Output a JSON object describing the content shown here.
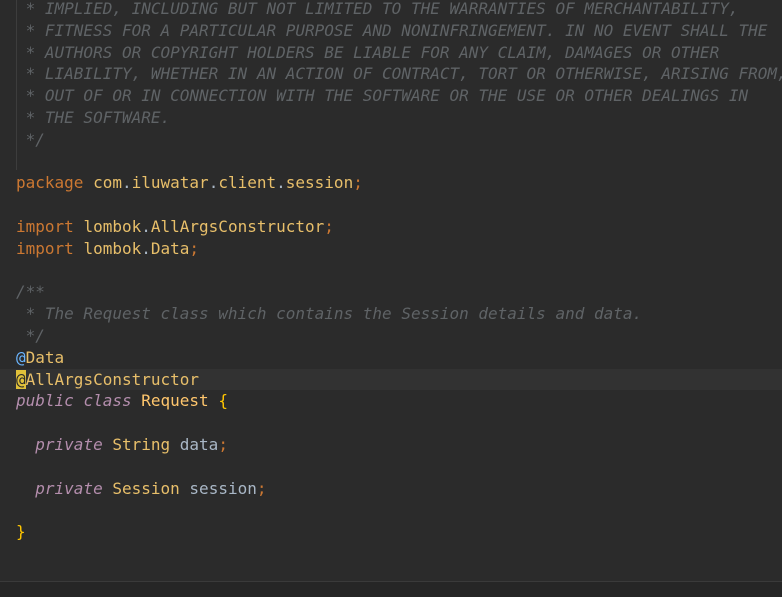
{
  "comment_header": [
    " * IMPLIED, INCLUDING BUT NOT LIMITED TO THE WARRANTIES OF MERCHANTABILITY,",
    " * FITNESS FOR A PARTICULAR PURPOSE AND NONINFRINGEMENT. IN NO EVENT SHALL THE",
    " * AUTHORS OR COPYRIGHT HOLDERS BE LIABLE FOR ANY CLAIM, DAMAGES OR OTHER",
    " * LIABILITY, WHETHER IN AN ACTION OF CONTRACT, TORT OR OTHERWISE, ARISING FROM,",
    " * OUT OF OR IN CONNECTION WITH THE SOFTWARE OR THE USE OR OTHER DEALINGS IN",
    " * THE SOFTWARE.",
    " */"
  ],
  "package_line": {
    "keyword": "package",
    "parts": [
      "com",
      "iluwatar",
      "client",
      "session"
    ]
  },
  "imports": [
    {
      "keyword": "import",
      "pkg": "lombok",
      "name": "AllArgsConstructor"
    },
    {
      "keyword": "import",
      "pkg": "lombok",
      "name": "Data"
    }
  ],
  "javadoc": [
    "/**",
    " * The Request class which contains the Session details and data.",
    " */"
  ],
  "annotations": [
    "Data",
    "AllArgsConstructor"
  ],
  "class_decl": {
    "modifier": "public",
    "keyword": "class",
    "name": "Request",
    "open": "{",
    "close": "}"
  },
  "fields": [
    {
      "modifier": "private",
      "type": "String",
      "name": "data"
    },
    {
      "modifier": "private",
      "type": "Session",
      "name": "session"
    }
  ],
  "colors": {
    "background": "#2b2b2b",
    "current_line": "#323232",
    "comment": "#5f6366",
    "keyword": "#cc7832",
    "brace": "#ffc600"
  }
}
